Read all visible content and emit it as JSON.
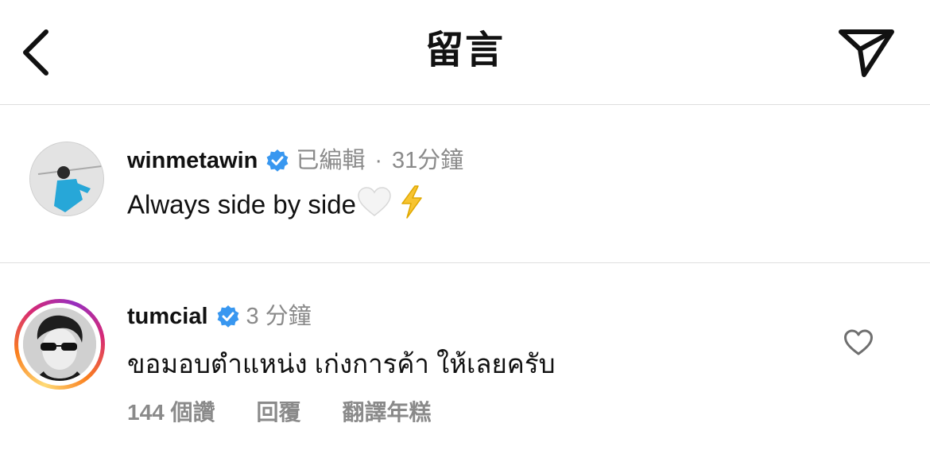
{
  "header": {
    "title": "留言",
    "back_icon": "chevron-left-icon",
    "share_icon": "paper-plane-icon"
  },
  "caption": {
    "username": "winmetawin",
    "verified": true,
    "edited_label": "已編輯",
    "separator": "·",
    "time": "31分鐘",
    "text": "Always side by side",
    "emojis": [
      "white-heart-emoji",
      "lightning-emoji"
    ]
  },
  "comment": {
    "username": "tumcial",
    "verified": true,
    "time": "3 分鐘",
    "text": "ขอมอบตำแหน่ง เก่งการค้า ให้เลยครับ",
    "likes_label": "144 個讚",
    "reply_label": "回覆",
    "translate_label": "翻譯年糕",
    "like_icon": "heart-outline-icon"
  },
  "colors": {
    "verified_blue": "#3897f0",
    "muted_text": "#8a8a8a",
    "divider": "#dedede"
  }
}
